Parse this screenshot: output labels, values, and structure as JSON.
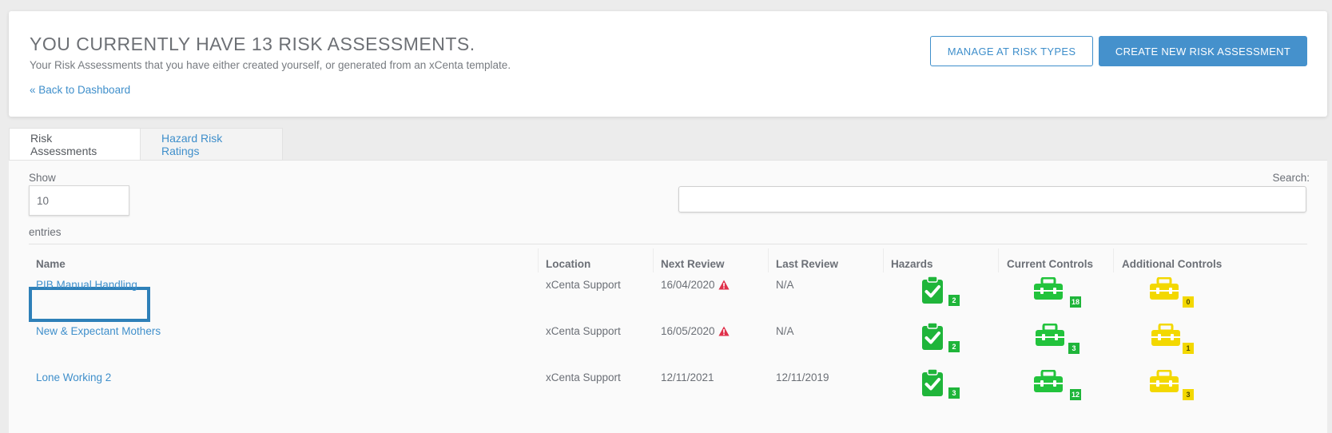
{
  "header": {
    "title": "YOU CURRENTLY HAVE 13 RISK ASSESSMENTS.",
    "subtitle": "Your Risk Assessments that you have either created yourself, or generated from an xCenta template.",
    "back_link": "« Back to Dashboard",
    "manage_button": "MANAGE AT RISK TYPES",
    "create_button": "CREATE NEW RISK ASSESSMENT"
  },
  "tabs": [
    {
      "label": "Risk Assessments",
      "active": true
    },
    {
      "label": "Hazard Risk Ratings",
      "active": false
    }
  ],
  "table_controls": {
    "show_label": "Show",
    "show_value": "10",
    "entries_label": "entries",
    "search_label": "Search:",
    "search_value": ""
  },
  "columns": [
    "Name",
    "Location",
    "Next Review",
    "Last Review",
    "Hazards",
    "Current Controls",
    "Additional Controls"
  ],
  "rows": [
    {
      "name": "PIB Manual Handling",
      "location": "xCenta Support",
      "next_review": "16/04/2020",
      "next_review_overdue": true,
      "last_review": "N/A",
      "hazards": "2",
      "current_controls": "18",
      "additional_controls": "0"
    },
    {
      "name": "New & Expectant Mothers",
      "location": "xCenta Support",
      "next_review": "16/05/2020",
      "next_review_overdue": true,
      "last_review": "N/A",
      "hazards": "2",
      "current_controls": "3",
      "additional_controls": "1"
    },
    {
      "name": "Lone Working 2",
      "location": "xCenta Support",
      "next_review": "12/11/2021",
      "next_review_overdue": false,
      "last_review": "12/11/2019",
      "hazards": "3",
      "current_controls": "12",
      "additional_controls": "3"
    }
  ],
  "colors": {
    "accent": "#3f8fcb",
    "primary_button": "#4591cc",
    "hazard_green": "#1fb53a",
    "control_green": "#22c33c",
    "additional_yellow": "#f3d800",
    "warning_red": "#e0304a"
  },
  "icons": {
    "hazards": "clipboard-check-icon",
    "current_controls": "toolbox-icon",
    "additional_controls": "toolbox-icon",
    "overdue": "warning-triangle-icon"
  }
}
